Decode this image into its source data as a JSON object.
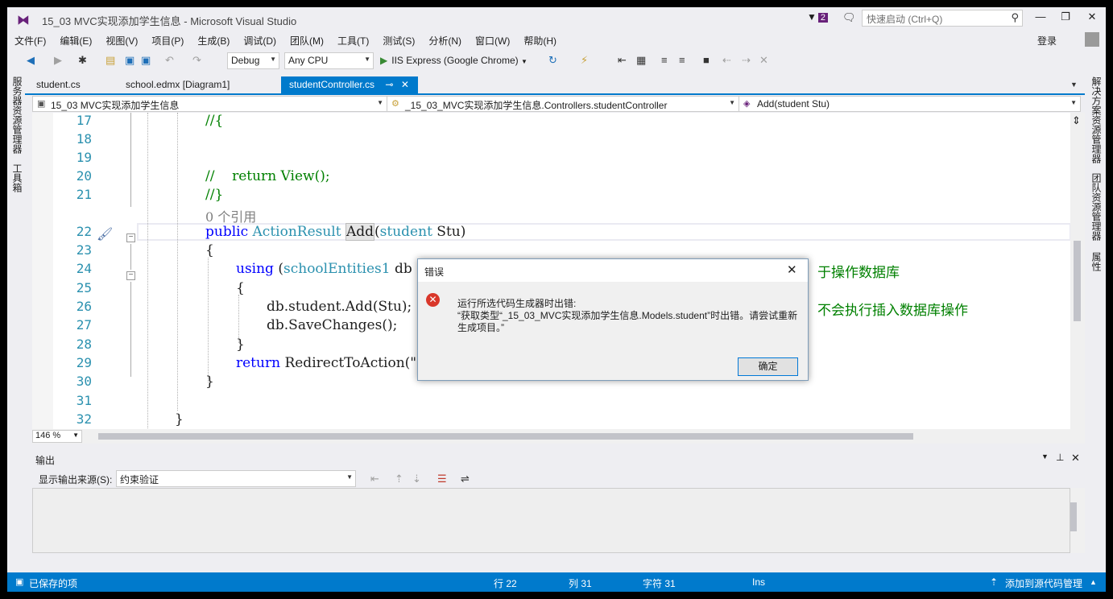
{
  "window": {
    "title": "15_03 MVC实现添加学生信息 - Microsoft Visual Studio"
  },
  "titlebar": {
    "notification_count": "2",
    "quick_launch_placeholder": "快速启动 (Ctrl+Q)",
    "minimize": "—",
    "restore": "❐",
    "close": "✕"
  },
  "menu": [
    "文件(F)",
    "编辑(E)",
    "视图(V)",
    "项目(P)",
    "生成(B)",
    "调试(D)",
    "团队(M)",
    "工具(T)",
    "测试(S)",
    "分析(N)",
    "窗口(W)",
    "帮助(H)"
  ],
  "account": {
    "login": "登录"
  },
  "toolbar": {
    "config": "Debug",
    "platform": "Any CPU",
    "run_target": "IIS Express (Google Chrome)"
  },
  "left_tabs": [
    "服务器资源管理器",
    "工具箱"
  ],
  "right_tabs": [
    "解决方案资源管理器",
    "团队资源管理器",
    "属性"
  ],
  "doc_tabs": [
    {
      "label": "student.cs",
      "active": false
    },
    {
      "label": "school.edmx [Diagram1]",
      "active": false
    },
    {
      "label": "studentController.cs",
      "active": true
    }
  ],
  "navbar": {
    "project": "15_03 MVC实现添加学生信息",
    "class": "_15_03_MVC实现添加学生信息.Controllers.studentController",
    "member": "Add(student Stu)"
  },
  "editor": {
    "line_numbers": [
      "17",
      "18",
      "19",
      "20",
      "21",
      "22",
      "23",
      "24",
      "25",
      "26",
      "27",
      "28",
      "29",
      "30",
      "31",
      "32"
    ],
    "lines": {
      "l17": "//{",
      "l20_a": "//",
      "l20_b": "return View();",
      "l21": "//}",
      "refs": "0 个引用",
      "l22_public": "public",
      "l22_type": "ActionResult",
      "l22_name": "Add",
      "l22_paren": "(",
      "l22_ptype": "student",
      "l22_rest": " Stu)",
      "l23": "{",
      "l24_using": "using",
      "l24_paren": " (",
      "l24_type": "schoolEntities1",
      "l24_rest": " db",
      "l24_comment_tail": "于操作数据库",
      "l25": "{",
      "l26": "db.student.Add(Stu);",
      "l26_comment_tail": "不会执行插入数据库操作",
      "l27": "db.SaveChanges();",
      "l28": "}",
      "l29_return": "return",
      "l29_rest": " RedirectToAction(\"",
      "l30": "}",
      "l32": "}"
    },
    "zoom": "146 %"
  },
  "output": {
    "title": "输出",
    "source_label": "显示输出来源(S):",
    "source_value": "约束验证"
  },
  "status": {
    "message": "已保存的项",
    "line": "行 22",
    "col": "列 31",
    "char": "字符 31",
    "mode": "Ins",
    "source_control": "添加到源代码管理"
  },
  "dialog": {
    "title": "错误",
    "message_line1": "运行所选代码生成器时出错:",
    "message_line2": "“获取类型“_15_03_MVC实现添加学生信息.Models.student”时出错。请尝试重新生成项目。”",
    "ok": "确定"
  },
  "colors": {
    "accent": "#007acc",
    "keyword": "#0000ff",
    "type": "#2b91af",
    "comment": "#008000",
    "error": "#d9372a"
  }
}
